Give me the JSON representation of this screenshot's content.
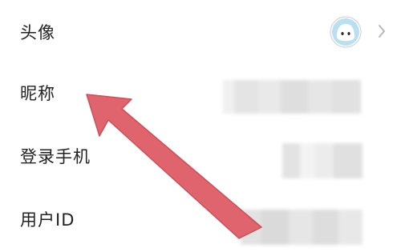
{
  "profile": {
    "rows": [
      {
        "label": "头像"
      },
      {
        "label": "昵称"
      },
      {
        "label": "登录手机"
      },
      {
        "label": "用户ID"
      }
    ]
  },
  "icons": {
    "avatar": "cartoon-face-avatar-icon",
    "chevron": "chevron-right-icon"
  },
  "annotation": {
    "arrow_color": "#e0646e",
    "pointing_at": "昵称"
  },
  "colors": {
    "text": "#222222",
    "avatar_bg": "#b9dff0",
    "avatar_ring": "#cfd6db",
    "chevron": "#b8b8b8",
    "redacted_gray": "#e2e2e2"
  }
}
